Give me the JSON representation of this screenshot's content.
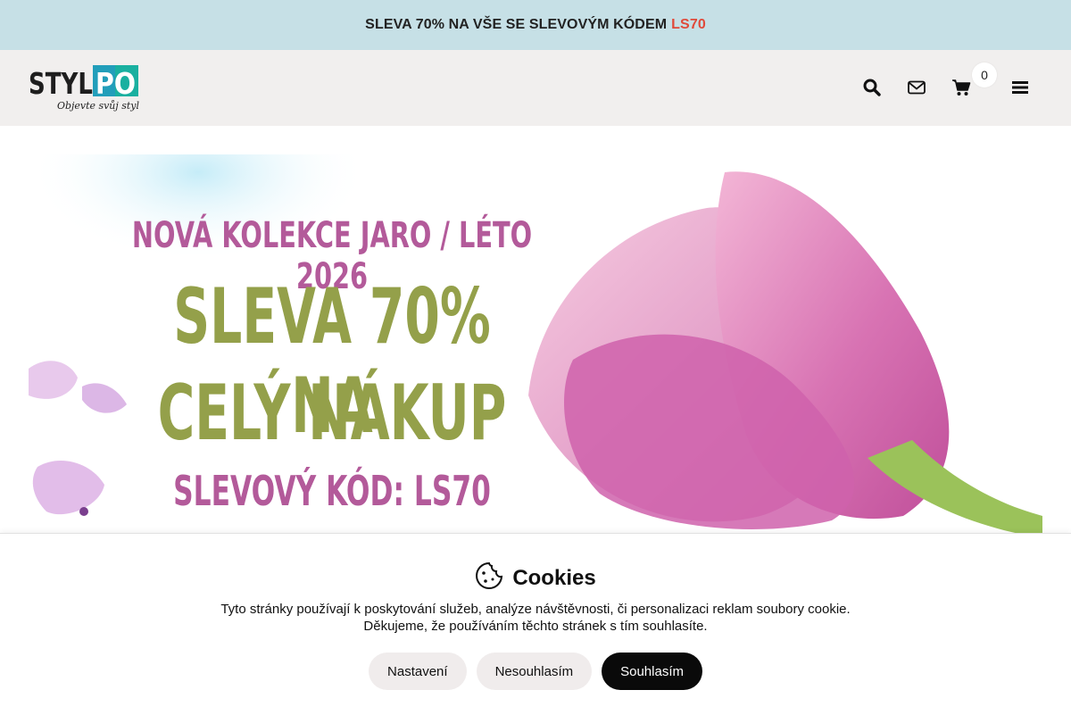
{
  "promo_bar": {
    "text": "SLEVA 70% NA VŠE SE SLEVOVÝM KÓDEM",
    "code": "LS70",
    "code_color": "#e04a3a"
  },
  "header": {
    "logo": {
      "text_dark": "STYL",
      "text_accent": "PO",
      "slogan": "Objevte svůj styl"
    },
    "icons": [
      "search-icon",
      "mail-icon",
      "cart-icon",
      "menu-icon"
    ],
    "cart_count": "0"
  },
  "banner": {
    "line1": "NOVÁ KOLEKCE JARO / LÉTO 2026",
    "line2": "SLEVA 70% NA",
    "line3": "CELÝ NÁKUP",
    "line4": "SLEVOVÝ KÓD: LS70",
    "colors": {
      "pink": "#b35a9a",
      "olive": "#94a04a"
    }
  },
  "cookies": {
    "title": "Cookies",
    "text_line1": "Tyto stránky používají k poskytování služeb, analýze návštěvnosti, či personalizaci reklam soubory cookie.",
    "text_line2": "Děkujeme, že používáním těchto stránek s tím souhlasíte.",
    "buttons": {
      "settings": "Nastavení",
      "decline": "Nesouhlasím",
      "accept": "Souhlasím"
    }
  }
}
